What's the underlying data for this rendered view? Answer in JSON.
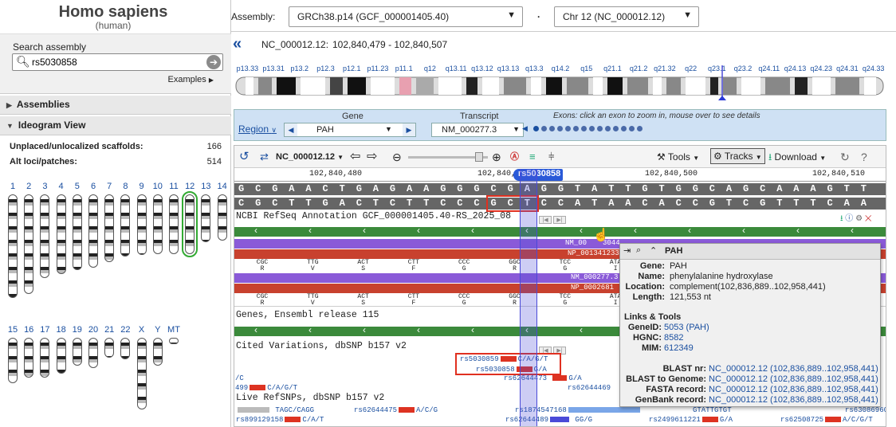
{
  "species": {
    "name": "Homo sapiens",
    "common": "(human)"
  },
  "search": {
    "label": "Search assembly",
    "value": "rs5030858",
    "examples": "Examples"
  },
  "sections": {
    "assemblies": "Assemblies",
    "ideogram": "Ideogram View"
  },
  "stats": [
    {
      "label": "Unplaced/unlocalized scaffolds:",
      "value": "166"
    },
    {
      "label": "Alt loci/patches:",
      "value": "514"
    }
  ],
  "chromosomes_row1": [
    "1",
    "2",
    "3",
    "4",
    "5",
    "6",
    "7",
    "8",
    "9",
    "10",
    "11",
    "12",
    "13",
    "14"
  ],
  "chromosomes_row2": [
    "15",
    "16",
    "17",
    "18",
    "19",
    "20",
    "21",
    "22",
    "X",
    "Y",
    "MT"
  ],
  "topbar": {
    "assembly_label": "Assembly:",
    "assembly_value": "GRCh38.p14 (GCF_000001405.40)",
    "dot": "·",
    "chr_value": "Chr 12 (NC_000012.12)"
  },
  "location": {
    "accession": "NC_000012.12:",
    "range": "102,840,479 - 102,840,507"
  },
  "bands": [
    "p13.33",
    "p13.31",
    "p13.2",
    "p12.3",
    "p12.1",
    "p11.23",
    "p11.1",
    "q12",
    "q13.11",
    "q13.12",
    "q13.13",
    "q13.3",
    "q14.2",
    "q15",
    "q21.1",
    "q21.2",
    "q21.32",
    "q22",
    "q23.1",
    "q23.2",
    "q24.11",
    "q24.13",
    "q24.23",
    "q24.31",
    "q24.33"
  ],
  "nav": {
    "region_label": "Region",
    "gene_label": "Gene",
    "gene_value": "PAH",
    "transcript_label": "Transcript",
    "transcript_value": "NM_000277.3",
    "exons_hint": "Exons: click an exon to zoom in, mouse over to see details"
  },
  "toolbar": {
    "seq_id": "NC_000012.12",
    "tools": "Tools",
    "tracks": "Tracks",
    "download": "Download"
  },
  "ruler": {
    "t1": "102,840,480",
    "t2": "102,840,",
    "marker": "rs5030858",
    "t3": "102,840,500",
    "t4": "102,840,510"
  },
  "sequence": {
    "forward": [
      "G",
      "C",
      "G",
      "A",
      "A",
      "C",
      "T",
      "G",
      "A",
      "G",
      "A",
      "A",
      "G",
      "G",
      "G",
      "C",
      "G",
      "A",
      "G",
      "G",
      "T",
      "A",
      "T",
      "T",
      "G",
      "T",
      "G",
      "G",
      "C",
      "A",
      "G",
      "C",
      "A",
      "A",
      "A",
      "G",
      "T",
      "T"
    ],
    "reverse": [
      "C",
      "G",
      "C",
      "T",
      "T",
      "G",
      "A",
      "C",
      "T",
      "C",
      "T",
      "T",
      "C",
      "C",
      "C",
      "G",
      "C",
      "T",
      "C",
      "C",
      "A",
      "T",
      "A",
      "A",
      "C",
      "A",
      "C",
      "C",
      "G",
      "T",
      "C",
      "G",
      "T",
      "T",
      "T",
      "C",
      "A",
      "A"
    ]
  },
  "tracks": {
    "refseq": "NCBI RefSeq Annotation GCF_000001405.40-RS_2025_08",
    "ensembl": "Genes, Ensembl release 115",
    "cited": "Cited Variations, dbSNP b157 v2",
    "live": "Live RefSNPs, dbSNP b157 v2",
    "nm1": "NM_00",
    "nm1b": "3044",
    "np1": "NP_001341233",
    "nm2": "NM_000277.3",
    "np2": "NP_0002681"
  },
  "codons": [
    {
      "c": "CGC",
      "a": "R"
    },
    {
      "c": "TTG",
      "a": "V"
    },
    {
      "c": "ACT",
      "a": "S"
    },
    {
      "c": "CTT",
      "a": "F"
    },
    {
      "c": "CCC",
      "a": "G"
    },
    {
      "c": "GGC",
      "a": "R"
    },
    {
      "c": "TCC",
      "a": "G"
    },
    {
      "c": "ATA",
      "a": "I"
    }
  ],
  "variants": {
    "cited1_id": "rs5030859",
    "cited1_allele": "C/A/G/T",
    "cited2_id": "rs5030858",
    "cited2_allele": "G/A",
    "v3_id": "rs62644473",
    "v3_allele": "G/A",
    "v4_id": "rs62644469",
    "left1": "/C",
    "left2_id": "499",
    "left2_allele": "C/A/G/T",
    "live1_allele": "TAGC/CAGG",
    "live1b_id": "rs62644475",
    "live1b_allele": "A/C/G",
    "live1c_id": "rs1874547168",
    "live1d": "GTATTGTGT",
    "live1e_id": "rs63086960",
    "live2_id": "rs899129158",
    "live2_allele": "C/A/T",
    "live2b_id": "rs62644489",
    "live2b_allele": "GG/G",
    "live2c_id": "rs2499611221",
    "live2c_allele": "G/A",
    "live2d_id": "rs62508725",
    "live2d_allele": "A/C/G/T"
  },
  "popup": {
    "title": "PAH",
    "gene_k": "Gene:",
    "gene_v": "PAH",
    "name_k": "Name:",
    "name_v": "phenylalanine hydroxylase",
    "loc_k": "Location:",
    "loc_v": "complement(102,836,889..102,958,441)",
    "len_k": "Length:",
    "len_v": "121,553 nt",
    "links_title": "Links & Tools",
    "geneid_k": "GeneID:",
    "geneid_v": "5053 (PAH)",
    "hgnc_k": "HGNC:",
    "hgnc_v": "8582",
    "mim_k": "MIM:",
    "mim_v": "612349",
    "blastnr_k": "BLAST nr:",
    "blastnr_v": "NC_000012.12 (102,836,889..102,958,441)",
    "blastg_k": "BLAST to Genome:",
    "blastg_v": "NC_000012.12 (102,836,889..102,958,441)",
    "fasta_k": "FASTA record:",
    "fasta_v": "NC_000012.12 (102,836,889..102,958,441)",
    "genbank_k": "GenBank record:",
    "genbank_v": "NC_000012.12 (102,836,889..102,958,441)"
  },
  "colors": {
    "accent": "#1a4fa0",
    "select": "#4a4ad8",
    "gene_green": "#3b8a3b",
    "mrna_purple": "#8a5ad8",
    "protein_red": "#c8412e",
    "highlight_red": "#e03020"
  }
}
